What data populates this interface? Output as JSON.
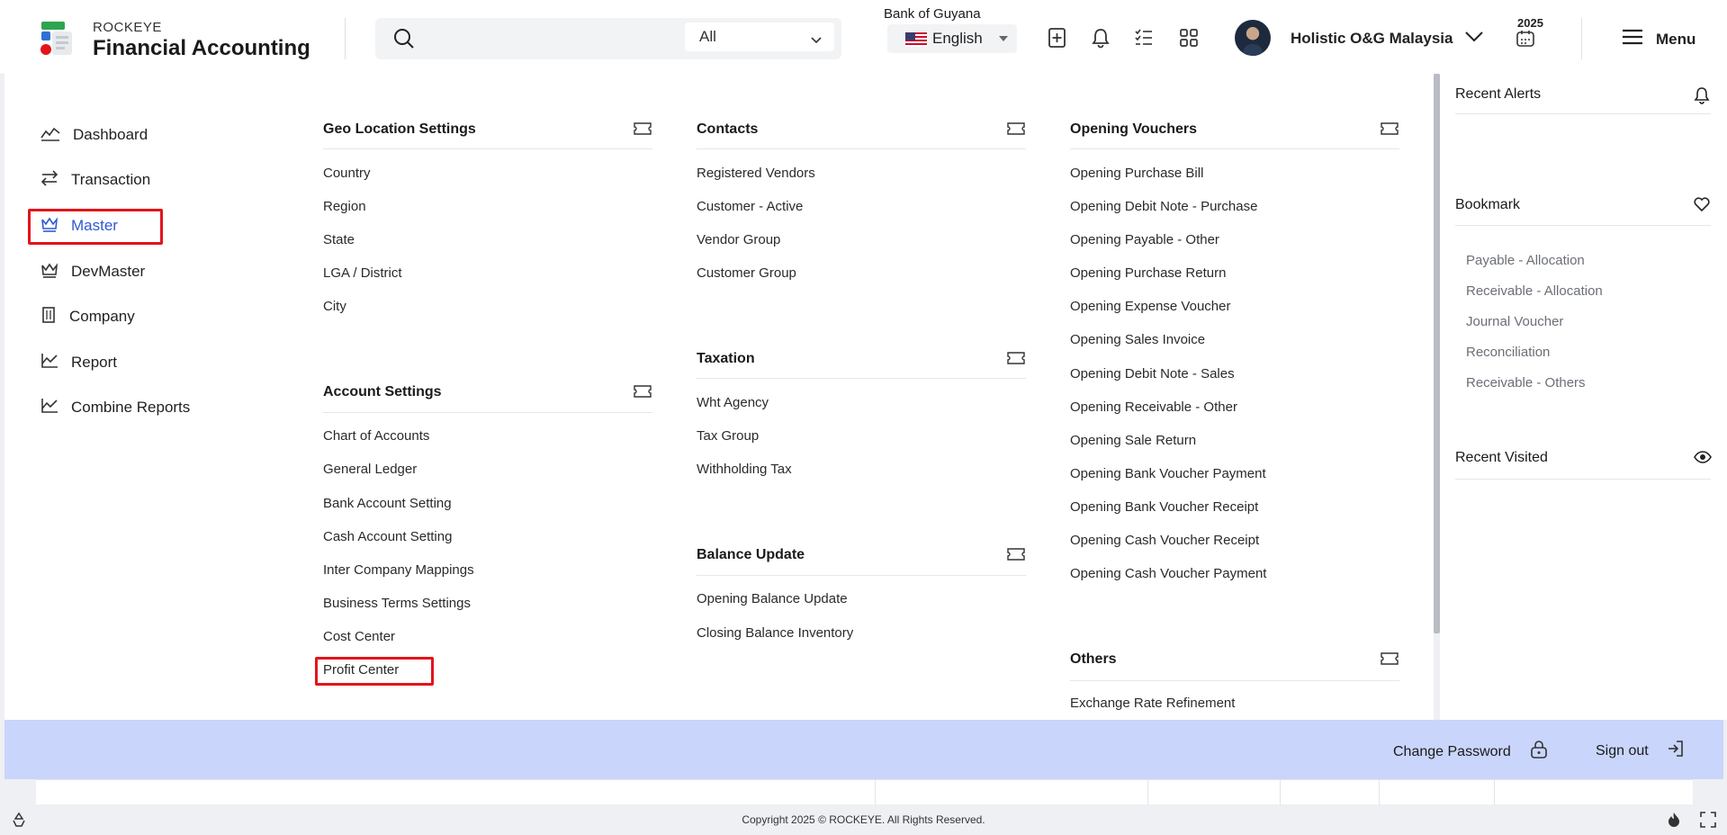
{
  "header": {
    "brand_small": "ROCKEYE",
    "brand_big": "Financial Accounting",
    "search_placeholder": "",
    "search_scope": "All",
    "language": "English",
    "user_name": "Holistic O&G Malaysia",
    "year": "2025",
    "menu_label": "Menu"
  },
  "leftnav": {
    "items": [
      {
        "label": "Dashboard",
        "icon": "chart-line-icon"
      },
      {
        "label": "Transaction",
        "icon": "arrows-exchange-icon"
      },
      {
        "label": "Master",
        "icon": "crown-icon",
        "active": true
      },
      {
        "label": "DevMaster",
        "icon": "crown-icon"
      },
      {
        "label": "Company",
        "icon": "building-icon"
      },
      {
        "label": "Report",
        "icon": "report-chart-icon"
      },
      {
        "label": "Combine Reports",
        "icon": "report-chart-icon"
      }
    ]
  },
  "mega": {
    "geo": {
      "title": "Geo Location Settings",
      "links": [
        "Country",
        "Region",
        "State",
        "LGA / District",
        "City"
      ]
    },
    "account": {
      "title": "Account Settings",
      "links": [
        "Chart of Accounts",
        "General Ledger",
        "Bank Account Setting",
        "Cash Account Setting",
        "Inter Company Mappings",
        "Business Terms Settings",
        "Cost Center",
        "Profit Center"
      ]
    },
    "contacts": {
      "title": "Contacts",
      "links": [
        "Registered Vendors",
        "Customer - Active",
        "Vendor Group",
        "Customer Group"
      ]
    },
    "taxation": {
      "title": "Taxation",
      "links": [
        "Wht Agency",
        "Tax Group",
        "Withholding Tax"
      ]
    },
    "balance": {
      "title": "Balance Update",
      "links": [
        "Opening Balance Update",
        "Closing Balance Inventory"
      ]
    },
    "opening": {
      "title": "Opening Vouchers",
      "links": [
        "Opening Purchase Bill",
        "Opening Debit Note - Purchase",
        "Opening Payable - Other",
        "Opening Purchase Return",
        "Opening Expense Voucher",
        "Opening Sales Invoice",
        "Opening Debit Note - Sales",
        "Opening Receivable - Other",
        "Opening Sale Return",
        "Opening Bank Voucher Payment",
        "Opening Bank Voucher Receipt",
        "Opening Cash Voucher Receipt",
        "Opening Cash Voucher Payment"
      ]
    },
    "others": {
      "title": "Others",
      "links": [
        "Exchange Rate Refinement"
      ]
    }
  },
  "rightpanel": {
    "recent_alerts": "Recent Alerts",
    "bookmark": "Bookmark",
    "bookmarks": [
      "Payable - Allocation",
      "Receivable - Allocation",
      "Journal Voucher",
      "Reconciliation",
      "Receivable - Others"
    ],
    "recent_visited": "Recent Visited"
  },
  "footerbar": {
    "change_password": "Change Password",
    "sign_out": "Sign out"
  },
  "background": {
    "row_text": "Bank of Guyana"
  },
  "copyright": "Copyright 2025 © ROCKEYE. All Rights Reserved.",
  "colors": {
    "accent": "#2f5bd3",
    "highlight": "#e3141b",
    "footer": "#c9d5fb"
  }
}
